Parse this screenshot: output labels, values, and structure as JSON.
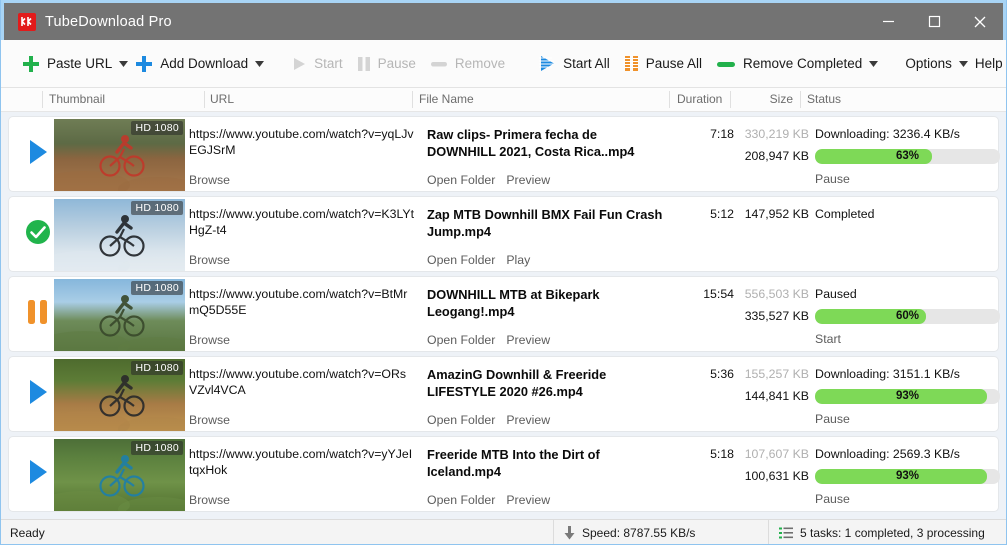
{
  "window": {
    "title": "TubeDownload Pro",
    "icon": "app-logo-icon",
    "minimize": "minimize-icon",
    "maximize": "maximize-icon",
    "close": "close-icon"
  },
  "toolbar": {
    "paste_url": "Paste URL",
    "add_download": "Add Download",
    "start": "Start",
    "pause": "Pause",
    "remove": "Remove",
    "start_all": "Start All",
    "pause_all": "Pause All",
    "remove_completed": "Remove Completed",
    "options": "Options",
    "help": "Help"
  },
  "columns": {
    "thumbnail": "Thumbnail",
    "url": "URL",
    "file_name": "File Name",
    "duration": "Duration",
    "size": "Size",
    "status": "Status"
  },
  "rows": [
    {
      "state": "downloading",
      "badge": "HD 1080",
      "url": "https://www.youtube.com/watch?v=yqLJvEGJSrM",
      "browse": "Browse",
      "file_name": "Raw clips- Primera fecha de DOWNHILL 2021, Costa Rica..mp4",
      "action1": "Open Folder",
      "action2": "Preview",
      "duration": "7:18",
      "size_total": "330,219 KB",
      "size_done": "208,947 KB",
      "status": "Downloading: 3236.4 KB/s",
      "percent": 63,
      "percent_label": "63%",
      "row_action": "Pause"
    },
    {
      "state": "completed",
      "badge": "HD 1080",
      "url": "https://www.youtube.com/watch?v=K3LYtHgZ-t4",
      "browse": "Browse",
      "file_name": "Zap MTB  Downhill  BMX  Fail  Fun  Crash  Jump.mp4",
      "action1": "Open Folder",
      "action2": "Play",
      "duration": "5:12",
      "size_total": "",
      "size_done": "147,952 KB",
      "status": "Completed",
      "percent": null,
      "percent_label": "",
      "row_action": ""
    },
    {
      "state": "paused",
      "badge": "HD 1080",
      "url": "https://www.youtube.com/watch?v=BtMrmQ5D55E",
      "browse": "Browse",
      "file_name": "DOWNHILL MTB at Bikepark Leogang!.mp4",
      "action1": "Open Folder",
      "action2": "Preview",
      "duration": "15:54",
      "size_total": "556,503 KB",
      "size_done": "335,527 KB",
      "status": "Paused",
      "percent": 60,
      "percent_label": "60%",
      "row_action": "Start"
    },
    {
      "state": "downloading",
      "badge": "HD 1080",
      "url": "https://www.youtube.com/watch?v=ORsVZvl4VCA",
      "browse": "Browse",
      "file_name": "AmazinG Downhill & Freeride LIFESTYLE 2020 #26.mp4",
      "action1": "Open Folder",
      "action2": "Preview",
      "duration": "5:36",
      "size_total": "155,257 KB",
      "size_done": "144,841 KB",
      "status": "Downloading: 3151.1 KB/s",
      "percent": 93,
      "percent_label": "93%",
      "row_action": "Pause"
    },
    {
      "state": "downloading",
      "badge": "HD 1080",
      "url": "https://www.youtube.com/watch?v=yYJeItqxHok",
      "browse": "Browse",
      "file_name": "Freeride MTB Into the Dirt of Iceland.mp4",
      "action1": "Open Folder",
      "action2": "Preview",
      "duration": "5:18",
      "size_total": "107,607 KB",
      "size_done": "100,631 KB",
      "status": "Downloading: 2569.3 KB/s",
      "percent": 93,
      "percent_label": "93%",
      "row_action": "Pause"
    }
  ],
  "statusbar": {
    "ready": "Ready",
    "speed": "Speed: 8787.55 KB/s",
    "tasks": "5 tasks: 1 completed, 3 processing",
    "speed_icon": "download-arrow-icon",
    "tasks_icon": "task-list-icon"
  },
  "colors": {
    "titlebar": "#737373",
    "window_border": "#a8d4f5",
    "accent_green": "#7ed957",
    "accent_blue": "#1d8ae0",
    "accent_orange": "#f0922b",
    "red_logo": "#e21b1b"
  }
}
